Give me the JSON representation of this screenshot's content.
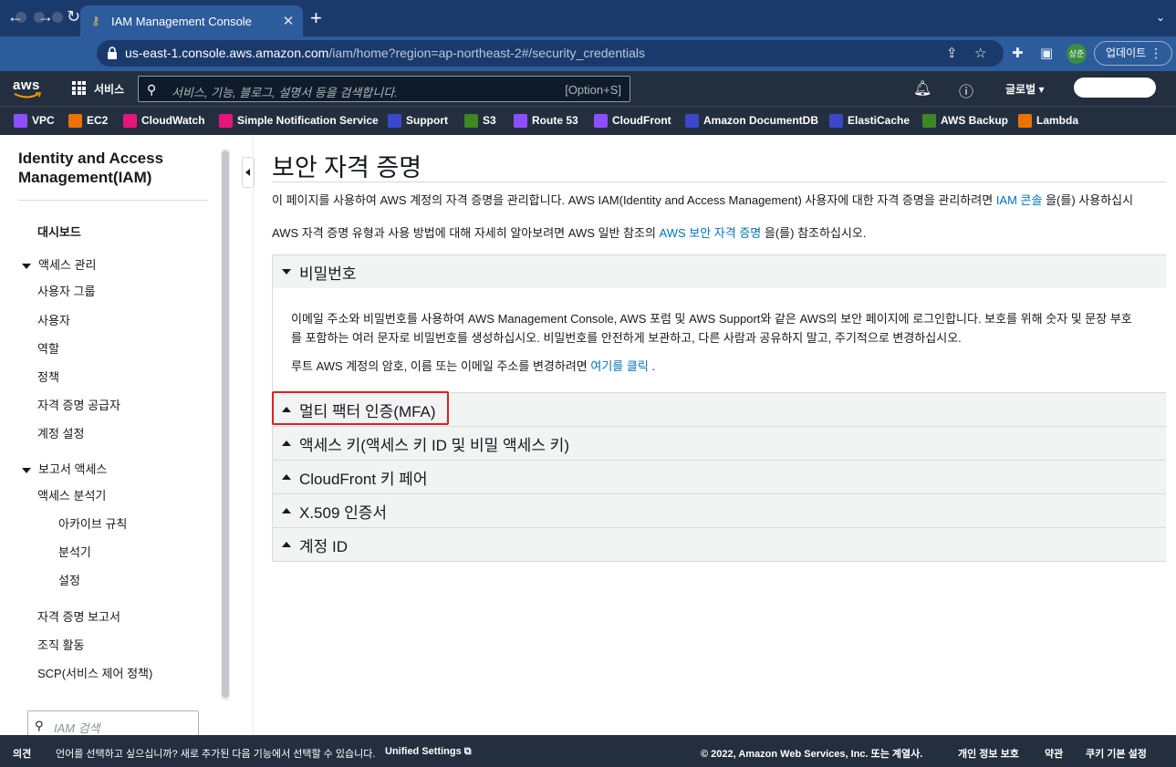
{
  "browser": {
    "tab_title": "IAM Management Console",
    "url_host": "us-east-1.console.aws.amazon.com",
    "url_path": "/iam/home?region=ap-northeast-2#/security_credentials",
    "profile_initials": "상준",
    "update_label": "업데이트"
  },
  "aws_nav": {
    "services_label": "서비스",
    "search_placeholder": "서비스, 기능, 블로그, 설명서 등을 검색합니다.",
    "search_shortcut": "[Option+S]",
    "region_label": "글로벌"
  },
  "favorites": [
    {
      "label": "VPC",
      "color": "#8c4fff"
    },
    {
      "label": "EC2",
      "color": "#ed7100"
    },
    {
      "label": "CloudWatch",
      "color": "#e7157b"
    },
    {
      "label": "Simple Notification Service",
      "color": "#e7157b"
    },
    {
      "label": "Support",
      "color": "#3b48cc"
    },
    {
      "label": "S3",
      "color": "#3f8624"
    },
    {
      "label": "Route 53",
      "color": "#8c4fff"
    },
    {
      "label": "CloudFront",
      "color": "#8c4fff"
    },
    {
      "label": "Amazon DocumentDB",
      "color": "#3b48cc"
    },
    {
      "label": "ElastiCache",
      "color": "#3b48cc"
    },
    {
      "label": "AWS Backup",
      "color": "#3f8624"
    },
    {
      "label": "Lambda",
      "color": "#ed7100"
    }
  ],
  "sidebar": {
    "title": "Identity and Access Management(IAM)",
    "dashboard": "대시보드",
    "access_mgmt": "액세스 관리",
    "user_groups": "사용자 그룹",
    "users": "사용자",
    "roles": "역할",
    "policies": "정책",
    "identity_providers": "자격 증명 공급자",
    "account_settings": "계정 설정",
    "access_reports": "보고서 액세스",
    "access_analyzer": "액세스 분석기",
    "archive_rules": "아카이브 규칙",
    "analyzers": "분석기",
    "settings": "설정",
    "credential_report": "자격 증명 보고서",
    "org_activity": "조직 활동",
    "scp": "SCP(서비스 제어 정책)",
    "search_placeholder": "IAM 검색"
  },
  "main": {
    "title": "보안 자격 증명",
    "intro_1a": "이 페이지를 사용하여 AWS 계정의 자격 증명을 관리합니다. AWS IAM(Identity and Access Management) 사용자에 대한 자격 증명을 관리하려면 ",
    "intro_1_link": "IAM 콘솔",
    "intro_1b": " 을(를) 사용하십시",
    "intro_2a": "AWS 자격 증명 유형과 사용 방법에 대해 자세히 알아보려면 AWS 일반 참조의 ",
    "intro_2_link": "AWS 보안 자격 증명",
    "intro_2b": " 을(를) 참조하십시오.",
    "password": {
      "title": "비밀번호",
      "line1": "이메일 주소와 비밀번호를 사용하여 AWS Management Console, AWS 포럼 및 AWS Support와 같은 AWS의 보안 페이지에 로그인합니다. 보호를 위해 숫자 및 문장 부호",
      "line2": "를 포함하는 여러 문자로 비밀번호를 생성하십시오. 비밀번호를 안전하게 보관하고, 다른 사람과 공유하지 말고, 주기적으로 변경하십시오.",
      "line3a": "루트 AWS 계정의 암호, 이름 또는 이메일 주소를 변경하려면 ",
      "line3_link": "여기를 클릭",
      "line3b": " ."
    },
    "sections": [
      "멀티 팩터 인증(MFA)",
      "액세스 키(액세스 키 ID 및 비밀 액세스 키)",
      "CloudFront 키 페어",
      "X.509 인증서",
      "계정 ID"
    ]
  },
  "footer": {
    "feedback": "의견",
    "language_prompt": "언어를 선택하고 싶으십니까? 새로 추가된 다음 기능에서 선택할 수 있습니다.",
    "unified_settings": "Unified Settings",
    "copyright": "© 2022, Amazon Web Services, Inc. 또는 계열사.",
    "privacy": "개인 정보 보호",
    "terms": "약관",
    "cookie": "쿠키 기본 설정"
  }
}
